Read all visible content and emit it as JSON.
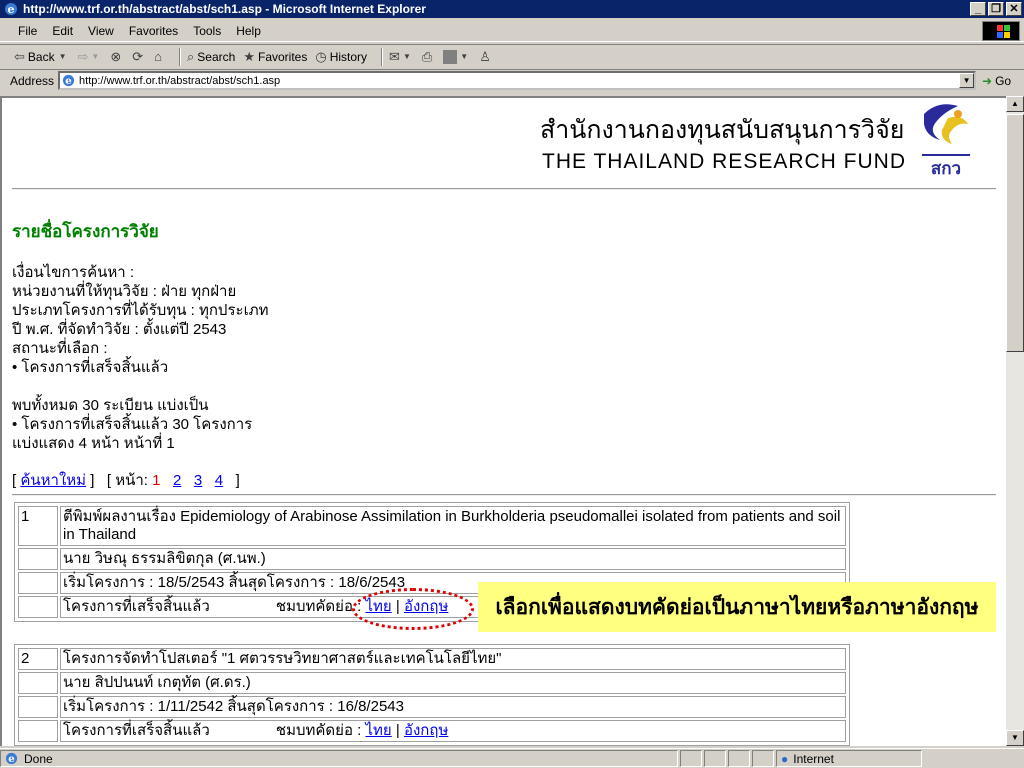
{
  "window": {
    "title": "http://www.trf.or.th/abstract/abst/sch1.asp - Microsoft Internet Explorer",
    "minimize": "_",
    "maximize": "❐",
    "close": "✕"
  },
  "menu": {
    "items": [
      "File",
      "Edit",
      "View",
      "Favorites",
      "Tools",
      "Help"
    ]
  },
  "toolbar": {
    "back": "Back",
    "search": "Search",
    "favorites": "Favorites",
    "history": "History"
  },
  "address": {
    "label": "Address",
    "url": "http://www.trf.or.th/abstract/abst/sch1.asp",
    "go": "Go"
  },
  "header": {
    "thai": "สำนักงานกองทุนสนับสนุนการวิจัย",
    "english": "THE THAILAND RESEARCH FUND",
    "logo_text": "สกว"
  },
  "page": {
    "title": "รายชื่อโครงการวิจัย",
    "criteria": [
      "เงื่อนไขการค้นหา :",
      "หน่วยงานที่ให้ทุนวิจัย : ฝ่าย ทุกฝ่าย",
      "ประเภทโครงการที่ได้รับทุน : ทุกประเภท",
      "ปี พ.ศ. ที่จัดทำวิจัย : ตั้งแต่ปี 2543",
      "สถานะที่เลือก :",
      "• โครงการที่เสร็จสิ้นแล้ว"
    ],
    "results": [
      "พบทั้งหมด 30 ระเบียน แบ่งเป็น",
      "• โครงการที่เสร็จสิ้นแล้ว 30 โครงการ",
      "แบ่งแสดง 4 หน้า     หน้าที่ 1"
    ],
    "pager": {
      "new_search": "ค้นหาใหม่",
      "page_label": "หน้า:",
      "current": "1",
      "pages": [
        "2",
        "3",
        "4"
      ]
    }
  },
  "records": [
    {
      "num": "1",
      "title": "ตีพิมพ์ผลงานเรื่อง Epidemiology of Arabinose Assimilation in Burkholderia pseudomallei isolated from patients and soil in Thailand",
      "researcher": "นาย  วิษณุ  ธรรมลิขิตกุล  (ศ.นพ.)",
      "dates": "เริ่มโครงการ : 18/5/2543   สิ้นสุดโครงการ : 18/6/2543",
      "status": "โครงการที่เสร็จสิ้นแล้ว",
      "abstract_label": "ชมบทคัดย่อ :",
      "thai_link": "ไทย",
      "english_link": "อังกฤษ"
    },
    {
      "num": "2",
      "title": "โครงการจัดทำโปสเตอร์ \"1 ศตวรรษวิทยาศาสตร์และเทคโนโลยีไทย\"",
      "researcher": "นาย  สิปปนนท์  เกตุทัต  (ศ.ดร.)",
      "dates": "เริ่มโครงการ : 1/11/2542   สิ้นสุดโครงการ : 16/8/2543",
      "status": "โครงการที่เสร็จสิ้นแล้ว",
      "abstract_label": "ชมบทคัดย่อ :",
      "thai_link": "ไทย",
      "english_link": "อังกฤษ"
    }
  ],
  "callout": "เลือกเพื่อแสดงบทคัดย่อเป็นภาษาไทยหรือภาษาอังกฤษ",
  "status": {
    "done": "Done",
    "zone": "Internet"
  }
}
